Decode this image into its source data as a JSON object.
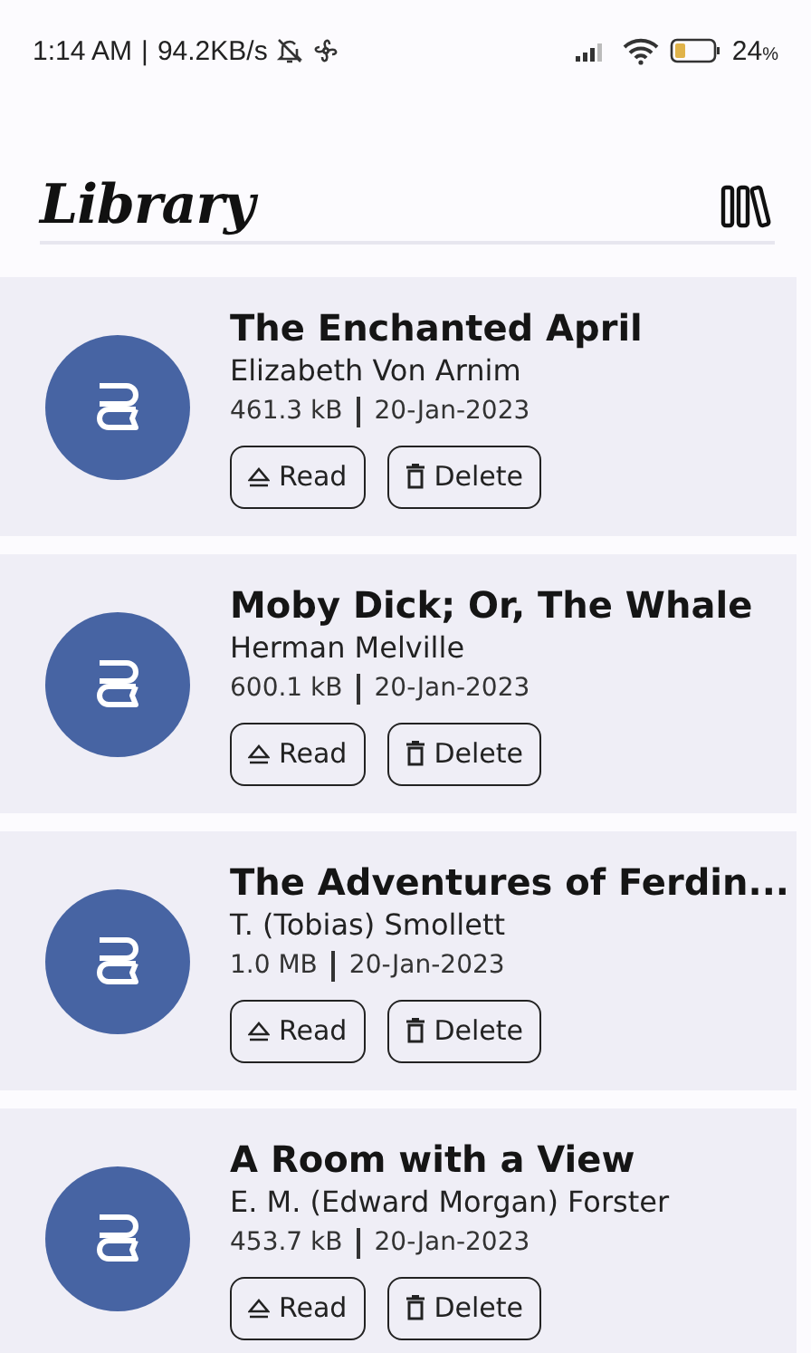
{
  "status_bar": {
    "time": "1:14 AM",
    "separator": "|",
    "speed": "94.2KB/s",
    "battery": "24",
    "battery_unit": "%"
  },
  "header": {
    "title": "Library"
  },
  "books": [
    {
      "title": "The Enchanted April",
      "author": "Elizabeth Von Arnim",
      "size": "461.3 kB",
      "date": "20-Jan-2023",
      "read_label": "Read",
      "delete_label": "Delete"
    },
    {
      "title": "Moby Dick; Or, The Whale",
      "author": "Herman Melville",
      "size": "600.1 kB",
      "date": "20-Jan-2023",
      "read_label": "Read",
      "delete_label": "Delete"
    },
    {
      "title": "The Adventures of Ferdin...",
      "author": "T. (Tobias) Smollett",
      "size": "1.0 MB",
      "date": "20-Jan-2023",
      "read_label": "Read",
      "delete_label": "Delete"
    },
    {
      "title": "A Room with a View",
      "author": "E. M. (Edward Morgan) Forster",
      "size": "453.7 kB",
      "date": "20-Jan-2023",
      "read_label": "Read",
      "delete_label": "Delete"
    }
  ]
}
